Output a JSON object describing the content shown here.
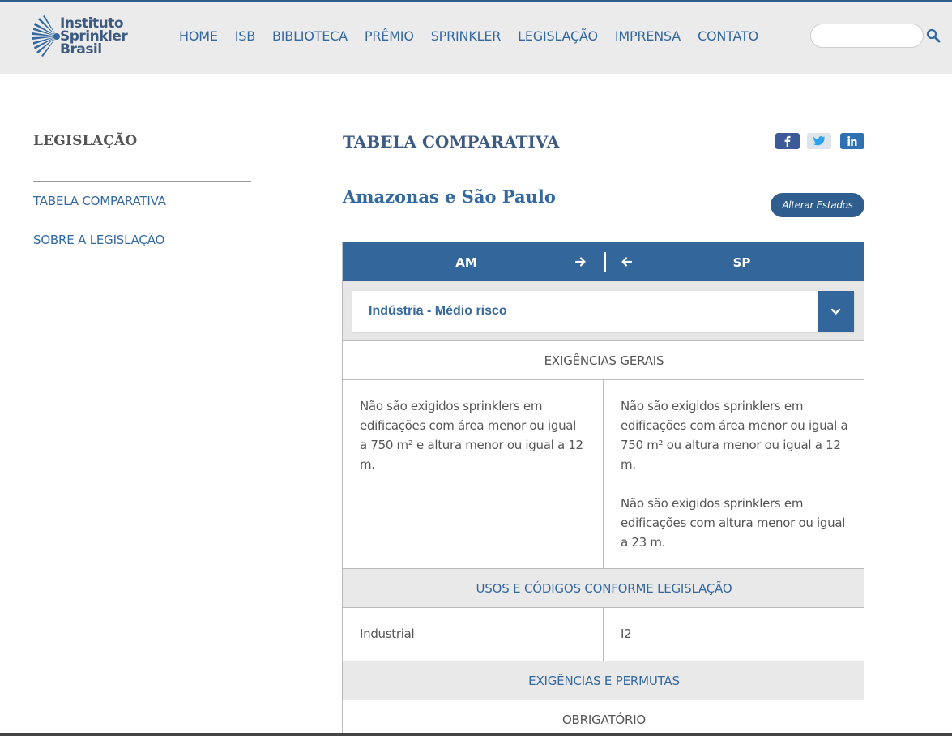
{
  "logo": {
    "line1": "Instituto",
    "line2": "Sprinkler",
    "line3": "Brasil"
  },
  "nav": [
    "HOME",
    "ISB",
    "BIBLIOTECA",
    "PRÊMIO",
    "SPRINKLER",
    "LEGISLAÇÃO",
    "IMPRENSA",
    "CONTATO"
  ],
  "search": {
    "placeholder": ""
  },
  "sidebar": {
    "title": "LEGISLAÇÃO",
    "items": [
      "TABELA COMPARATIVA",
      "SOBRE A LEGISLAÇÃO"
    ]
  },
  "main": {
    "title": "TABELA COMPARATIVA",
    "share": {
      "facebook": "f",
      "twitter": "twitter-icon",
      "linkedin": "in"
    },
    "states_title": "Amazonas e São Paulo",
    "change_button": "Alterar Estados"
  },
  "table": {
    "header": {
      "left": "AM",
      "right": "SP"
    },
    "select_value": "Indústria - Médio risco",
    "sections": {
      "general": "EXIGÊNCIAS GERAIS",
      "uses": "USOS E CÓDIGOS CONFORME LEGISLAÇÃO",
      "requirements": "EXIGÊNCIAS E PERMUTAS",
      "mandatory": "OBRIGATÓRIO"
    },
    "general_left": "Não são exigidos sprinklers em edificações com área menor ou igual a 750 m² e altura menor ou igual a 12 m.",
    "general_right_1": "Não são exigidos sprinklers em edificações com área menor ou igual a 750 m² ou altura menor ou igual a 12 m.",
    "general_right_2": "Não são exigidos sprinklers em edificações com altura menor ou igual a 23 m.",
    "uses_left": "Industrial",
    "uses_right": "I2"
  },
  "colors": {
    "brand": "#3469a0",
    "header_bg": "#33669a",
    "gray_band": "#e9e9e9"
  }
}
